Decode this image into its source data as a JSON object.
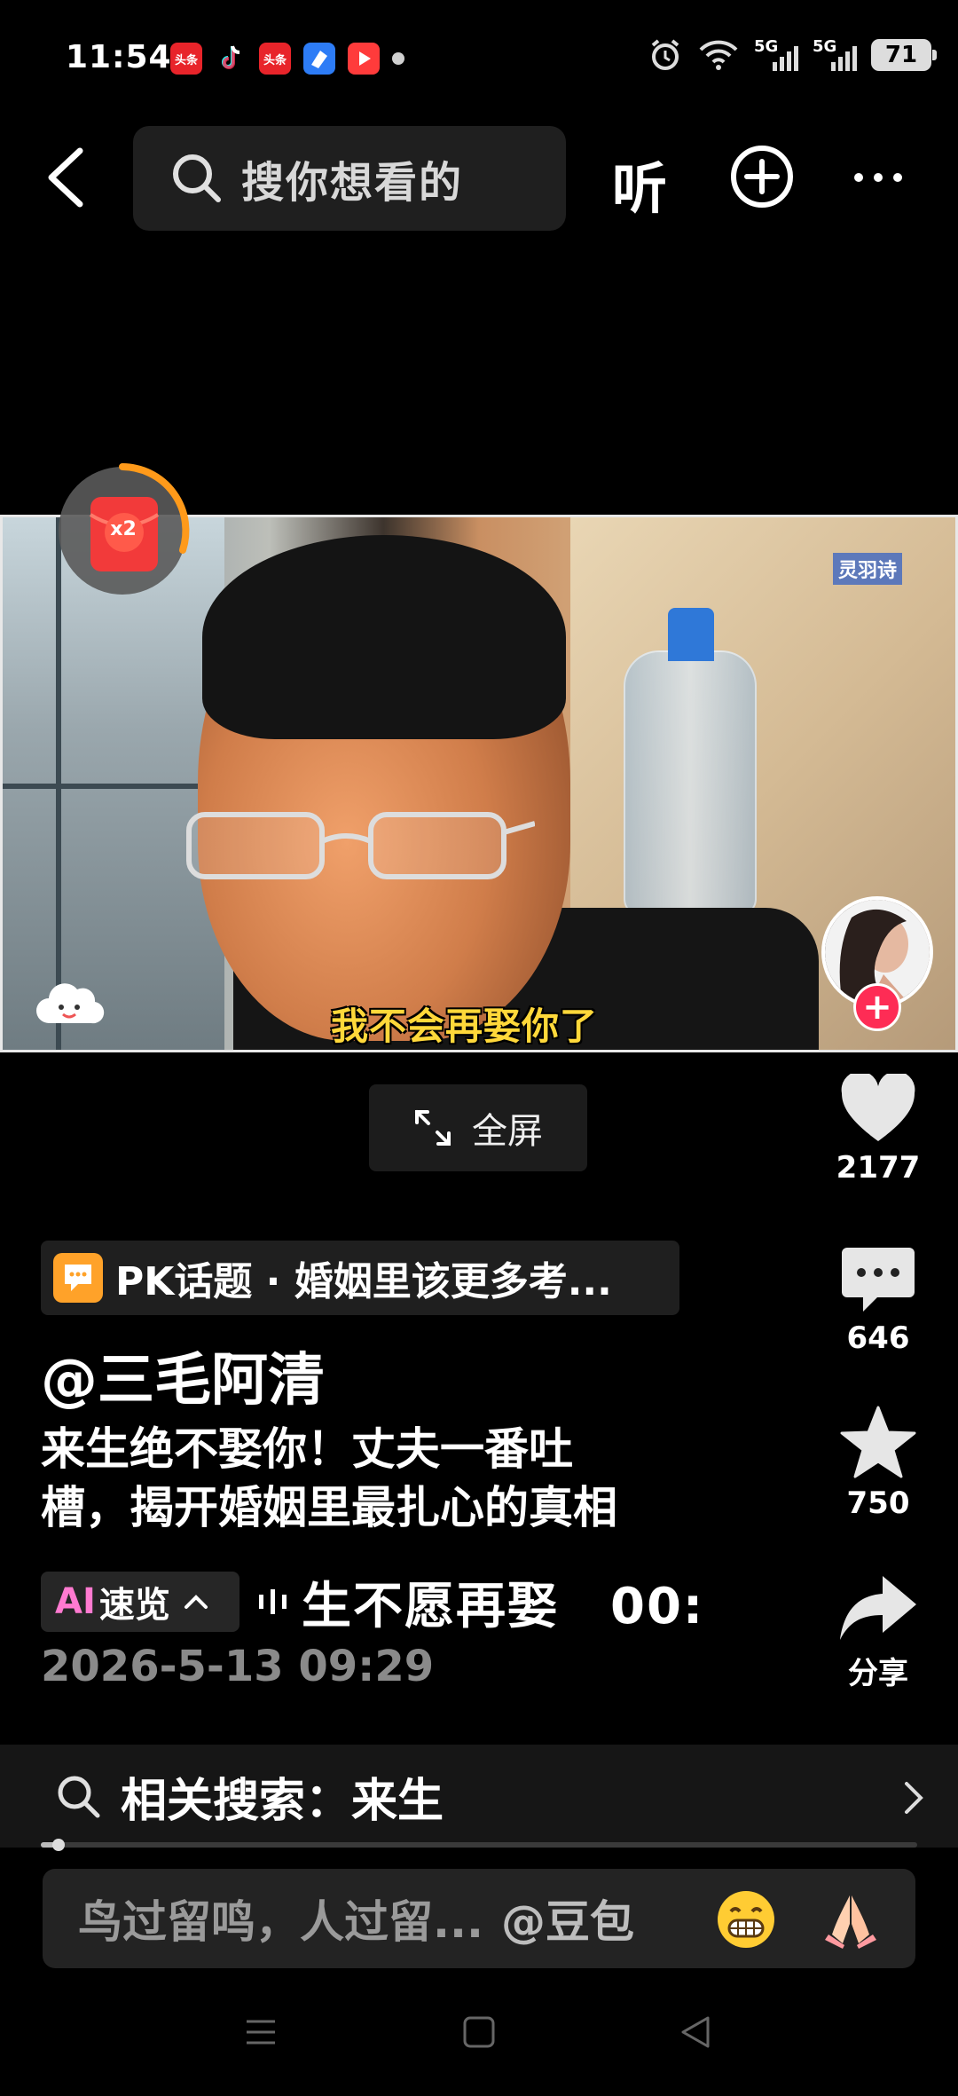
{
  "status_bar": {
    "time": "11:54",
    "apps": [
      {
        "name": "toutiao-app-icon",
        "label": "头条",
        "color": "#e8242a"
      },
      {
        "name": "douyin-app-icon",
        "label": "",
        "color": "#111111"
      },
      {
        "name": "toutiao-app-icon-2",
        "label": "头条",
        "color": "#e8242a"
      },
      {
        "name": "blue-app-icon",
        "label": "",
        "color": "#2d7cf6"
      },
      {
        "name": "video-app-icon",
        "label": "",
        "color": "#ff3b3b"
      }
    ],
    "sim1": "5G",
    "sim2": "5G",
    "battery": "71"
  },
  "top_nav": {
    "search_placeholder": "搜你想看的",
    "listen_label": "听"
  },
  "video": {
    "subtitle": "我不会再娶你了",
    "watermark": "灵羽诗",
    "redpacket_badge": "x2"
  },
  "fullscreen_label": "全屏",
  "actions": {
    "like_count": "2177",
    "comment_count": "646",
    "favorite_count": "750",
    "share_label": "分享"
  },
  "info": {
    "topic": "PK话题 · 婚姻里该更多考...",
    "author": "@三毛阿清",
    "description_line1": "来生绝不娶你！丈夫一番吐",
    "description_line2": "槽，揭开婚姻里最扎心的真相",
    "ai_prefix": "AI",
    "ai_label": "速览",
    "ai_ticker": "生不愿再娶　00:",
    "datetime": "2026-5-13 09:29"
  },
  "related_search": {
    "label": "相关搜索：来生"
  },
  "progress": {
    "value": 0.02
  },
  "comment_bar": {
    "placeholder": "鸟过留鸣，人过留...",
    "mention": "@豆包"
  },
  "colors": {
    "accent": "#fe2c55",
    "topic_icon": "#ffa229",
    "subtitle": "#ffd83a",
    "ai": "#ff7ad0"
  }
}
